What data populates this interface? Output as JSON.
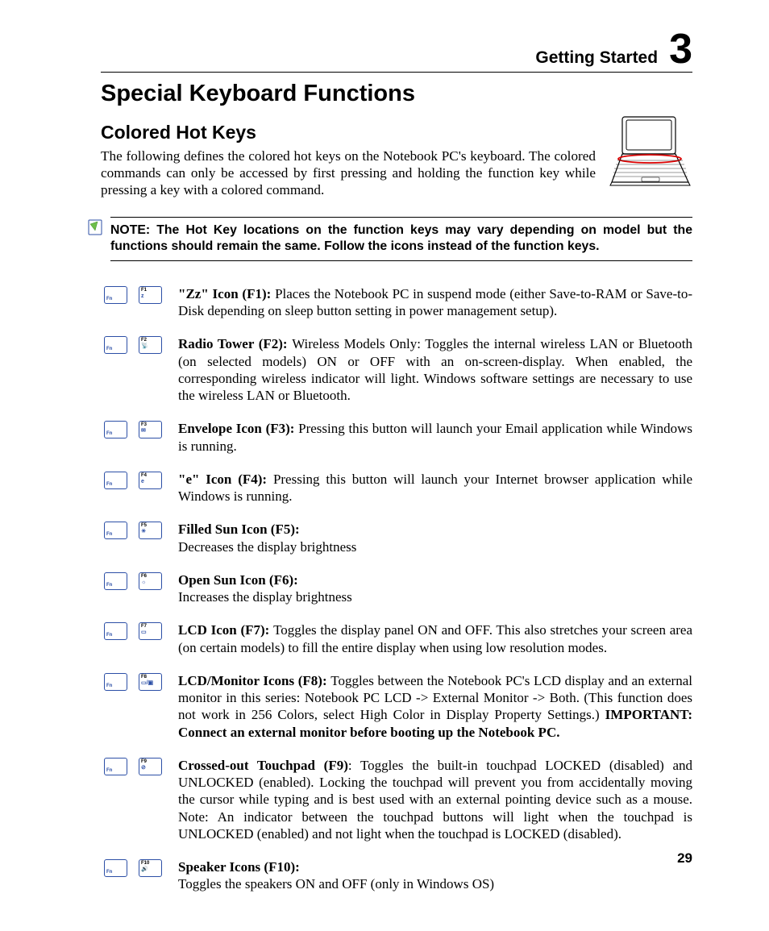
{
  "header": {
    "section": "Getting Started",
    "chapter": "3"
  },
  "heading": "Special Keyboard Functions",
  "subheading": "Colored Hot Keys",
  "intro": "The following defines the colored hot keys on the Notebook PC's keyboard. The colored commands can only be accessed by first pressing and holding the function key while pressing a key with a colored command.",
  "note": "NOTE: The Hot Key locations on the function keys may vary depending on model but the functions should remain the same. Follow the icons instead of the function keys.",
  "fnLabel": "Fn",
  "keys": [
    {
      "top": "F1",
      "icon": "z",
      "title": "\"Zz\" Icon (F1): ",
      "desc": "Places the Notebook PC in suspend mode (either Save-to-RAM or Save-to-Disk depending on sleep button setting in power management setup)."
    },
    {
      "top": "F2",
      "icon": "📡",
      "title": "Radio Tower (F2): ",
      "desc": "Wireless Models Only: Toggles the internal wireless LAN or Bluetooth (on selected models) ON or OFF with an on-screen-display. When enabled, the corresponding wireless indicator will light. Windows software settings are necessary to use the wireless LAN or Bluetooth."
    },
    {
      "top": "F3",
      "icon": "✉",
      "title": "Envelope Icon (F3): ",
      "desc": "Pressing this button will launch your Email application while Windows is running."
    },
    {
      "top": "F4",
      "icon": "e",
      "title": "\"e\" Icon (F4): ",
      "desc": "Pressing this button will launch your Internet browser application while Windows is running."
    },
    {
      "top": "F5",
      "icon": "☀",
      "title": "Filled Sun Icon (F5):",
      "desc": "Decreases the display brightness",
      "break": true
    },
    {
      "top": "F6",
      "icon": "☼",
      "title": "Open Sun Icon (F6):",
      "desc": "Increases the display brightness",
      "break": true
    },
    {
      "top": "F7",
      "icon": "▭",
      "title": "LCD Icon (F7): ",
      "desc": "Toggles the display panel ON and OFF. This also stretches your screen area (on certain models) to fill the entire display when using low resolution modes."
    },
    {
      "top": "F8",
      "icon": "▭/▣",
      "title": "LCD/Monitor Icons (F8): ",
      "desc": "Toggles between the Notebook PC's LCD display and an external monitor in this series: Notebook PC LCD -> External Monitor -> Both. (This function does not work in 256 Colors, select High Color in Display Property Settings.) ",
      "bold_tail": "IMPORTANT: Connect an external monitor before booting up the Notebook PC."
    },
    {
      "top": "F9",
      "icon": "⊘",
      "title": "Crossed-out Touchpad (F9)",
      "desc": ": Toggles the built-in touchpad LOCKED (disabled) and UNLOCKED (enabled). Locking the touchpad will prevent you from accidentally moving the cursor while typing and is best used with an external pointing device such as a mouse. Note: An indicator between the touchpad buttons will light when the touchpad is UNLOCKED (enabled) and not light when the touchpad is LOCKED (disabled)."
    },
    {
      "top": "F10",
      "icon": "🔊",
      "title": "Speaker Icons (F10):",
      "desc": "Toggles the speakers ON and OFF (only in Windows OS)",
      "break": true
    }
  ],
  "pageNumber": "29"
}
